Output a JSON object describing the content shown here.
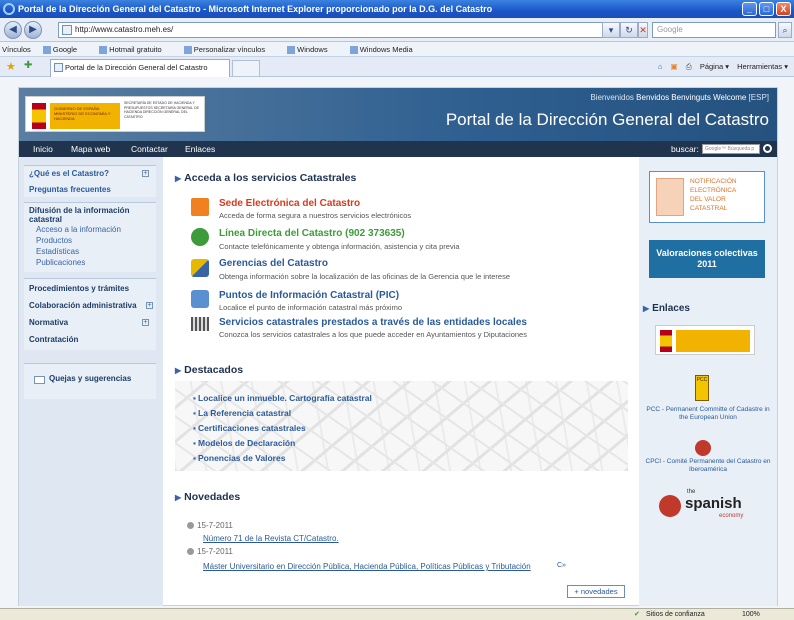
{
  "window": {
    "title": "Portal de la Dirección General del Catastro - Microsoft Internet Explorer proporcionado por la D.G. del Catastro",
    "min": "_",
    "max": "□",
    "close": "X"
  },
  "browser": {
    "back": "◀",
    "forward": "▶",
    "url": "http://www.catastro.meh.es/",
    "search_placeholder": "Google",
    "links_label": "Vínculos",
    "links": [
      "Google",
      "Hotmail gratuito",
      "Personalizar vínculos",
      "Windows",
      "Windows Media"
    ],
    "tab_title": "Portal de la Dirección General del Catastro",
    "tools": [
      "Página ▾",
      "Herramientas ▾"
    ],
    "status_trust": "Sitios de confianza",
    "zoom": "100%"
  },
  "header": {
    "welcome_prefix": "Bienvenidos",
    "welcome_langs": "Benvidos  Benvinguts  Welcome",
    "welcome_lang_code": "[ESP]",
    "portal_title": "Portal de la Dirección General del Catastro",
    "logo_left": "GOBIERNO DE ESPAÑA  MINISTERIO DE ECONOMÍA Y HACIENDA",
    "logo_right": "SECRETARÍA DE ESTADO DE HACIENDA Y PRESUPUESTOS  SECRETARÍA GENERAL DE HACIENDA  DIRECCIÓN GENERAL DEL CATASTRO"
  },
  "nav": {
    "items": [
      "Inicio",
      "Mapa web",
      "Contactar",
      "Enlaces"
    ],
    "search_label": "buscar:",
    "search_placeholder": "Google™ Búsqueda p"
  },
  "left": {
    "que_es": "¿Qué es el Catastro?",
    "preguntas": "Preguntas frecuentes",
    "difusion": "Difusión de la información catastral",
    "difusion_items": [
      "Acceso a la información",
      "Productos",
      "Estadísticas",
      "Publicaciones"
    ],
    "procedimientos": "Procedimientos y trámites",
    "colaboracion": "Colaboración administrativa",
    "normativa": "Normativa",
    "contratacion": "Contratación",
    "quejas": "Quejas y sugerencias",
    "plus": "+"
  },
  "main": {
    "services_title": "Acceda a los servicios Catastrales",
    "services": [
      {
        "title": "Sede Electrónica del Catastro",
        "desc": "Acceda de forma segura a nuestros servicios electrónicos",
        "color": "#d9391c"
      },
      {
        "title": "Línea Directa del Catastro (902 373635)",
        "desc": "Contacte telefónicamente y obtenga información, asistencia y cita previa",
        "color": "#3d9b3a"
      },
      {
        "title": "Gerencias del Catastro",
        "desc": "Obtenga información sobre la localización de las oficinas de la Gerencia que le interese",
        "color": "#2a5a9a"
      },
      {
        "title": "Puntos de Información Catastral (PIC)",
        "desc": "Localice el punto de información catastral más próximo",
        "color": "#2a5a9a"
      },
      {
        "title": "Servicios catastrales prestados a través de las entidades locales",
        "desc": "Conozca los servicios catastrales a los que puede acceder en Ayuntamientos y Diputaciones",
        "color": "#2a5a9a"
      }
    ],
    "destacados_title": "Destacados",
    "destacados": [
      "Localice un inmueble. Cartografía catastral",
      "La Referencia catastral",
      "Certificaciones catastrales",
      "Modelos de Declaración",
      "Ponencias de Valores"
    ],
    "novedades_title": "Novedades",
    "novedades": [
      {
        "date": "15-7-2011",
        "link": "Número 71 de la Revista CT/Catastro."
      },
      {
        "date": "15-7-2011",
        "link": "Máster Universitario en Dirección Pública, Hacienda Pública, Políticas Públicas y Tributación"
      }
    ],
    "more_novedades": "+ novedades",
    "ext_mark": "C»"
  },
  "right": {
    "notif": [
      "NOTIFICACIÓN",
      "ELECTRÓNICA",
      "DEL VALOR",
      "CATASTRAL"
    ],
    "valoraciones": "Valoraciones colectivas 2011",
    "enlaces_title": "Enlaces",
    "pcc_badge": "PCC",
    "pcc_text": "PCC - Permanent Committe of Cadastre in the European Union",
    "cpci_text": "CPCI - Comité Permanente del Catastro en Iberoamérica",
    "spanish_small": "the",
    "spanish_big": "spanish",
    "spanish_sub": "economy"
  }
}
